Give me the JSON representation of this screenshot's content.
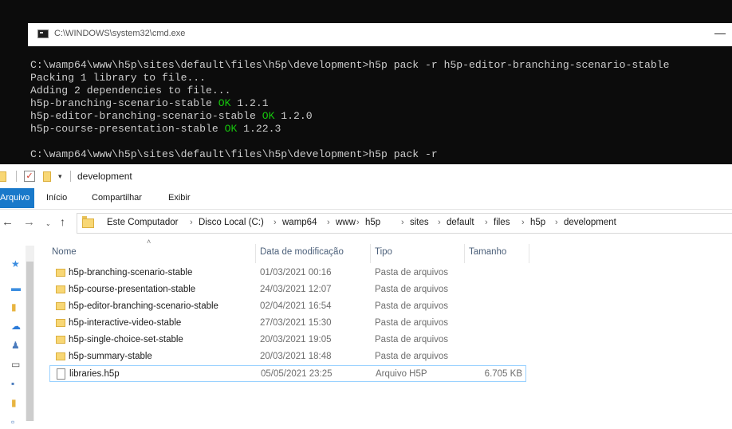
{
  "cmd": {
    "title": "C:\\WINDOWS\\system32\\cmd.exe",
    "minimize_glyph": "—",
    "lines": [
      {
        "parts": [
          {
            "text": "C:\\wamp64\\www\\h5p\\sites\\default\\files\\h5p\\development>h5p pack -r h5p-editor-branching-scenario-stable",
            "ok": false
          }
        ]
      },
      {
        "parts": [
          {
            "text": "Packing 1 library to file...",
            "ok": false
          }
        ]
      },
      {
        "parts": [
          {
            "text": "Adding 2 dependencies to file...",
            "ok": false
          }
        ]
      },
      {
        "parts": [
          {
            "text": "h5p-branching-scenario-stable ",
            "ok": false
          },
          {
            "text": "OK",
            "ok": true
          },
          {
            "text": " 1.2.1",
            "ok": false
          }
        ]
      },
      {
        "parts": [
          {
            "text": "h5p-editor-branching-scenario-stable ",
            "ok": false
          },
          {
            "text": "OK",
            "ok": true
          },
          {
            "text": " 1.2.0",
            "ok": false
          }
        ]
      },
      {
        "parts": [
          {
            "text": "h5p-course-presentation-stable ",
            "ok": false
          },
          {
            "text": "OK",
            "ok": true
          },
          {
            "text": " 1.22.3",
            "ok": false
          }
        ]
      },
      {
        "parts": [
          {
            "text": "",
            "ok": false
          }
        ]
      },
      {
        "parts": [
          {
            "text": "C:\\wamp64\\www\\h5p\\sites\\default\\files\\h5p\\development>h5p pack -r",
            "ok": false
          }
        ]
      }
    ]
  },
  "explorer": {
    "qat": {
      "title": "development",
      "check_glyph": "✓",
      "dropdown_glyph": "▾"
    },
    "ribbon": {
      "tabs": [
        "Arquivo",
        "Início",
        "Compartilhar",
        "Exibir"
      ]
    },
    "nav": {
      "back": "←",
      "forward": "→",
      "recent": "⌄",
      "up": "↑"
    },
    "breadcrumb": [
      "Este Computador",
      "Disco Local (C:)",
      "wamp64",
      "www",
      "h5p",
      "sites",
      "default",
      "files",
      "h5p",
      "development"
    ],
    "breadcrumb_sep": "›",
    "sort_arrow": "˄",
    "columns": [
      "Nome",
      "Data de modificação",
      "Tipo",
      "Tamanho"
    ],
    "files": [
      {
        "name": "h5p-branching-scenario-stable",
        "date": "01/03/2021 00:16",
        "type": "Pasta de arquivos",
        "size": "",
        "kind": "folder"
      },
      {
        "name": "h5p-course-presentation-stable",
        "date": "24/03/2021 12:07",
        "type": "Pasta de arquivos",
        "size": "",
        "kind": "folder"
      },
      {
        "name": "h5p-editor-branching-scenario-stable",
        "date": "02/04/2021 16:54",
        "type": "Pasta de arquivos",
        "size": "",
        "kind": "folder"
      },
      {
        "name": "h5p-interactive-video-stable",
        "date": "27/03/2021 15:30",
        "type": "Pasta de arquivos",
        "size": "",
        "kind": "folder"
      },
      {
        "name": "h5p-single-choice-set-stable",
        "date": "20/03/2021 19:05",
        "type": "Pasta de arquivos",
        "size": "",
        "kind": "folder"
      },
      {
        "name": "h5p-summary-stable",
        "date": "20/03/2021 18:48",
        "type": "Pasta de arquivos",
        "size": "",
        "kind": "folder"
      },
      {
        "name": "libraries.h5p",
        "date": "05/05/2021 23:25",
        "type": "Arquivo H5P",
        "size": "6.705 KB",
        "kind": "file",
        "selected": true
      }
    ],
    "colors": {
      "folder": "#f8d775",
      "accent": "#1979ca",
      "ok_green": "#16c60c"
    }
  }
}
